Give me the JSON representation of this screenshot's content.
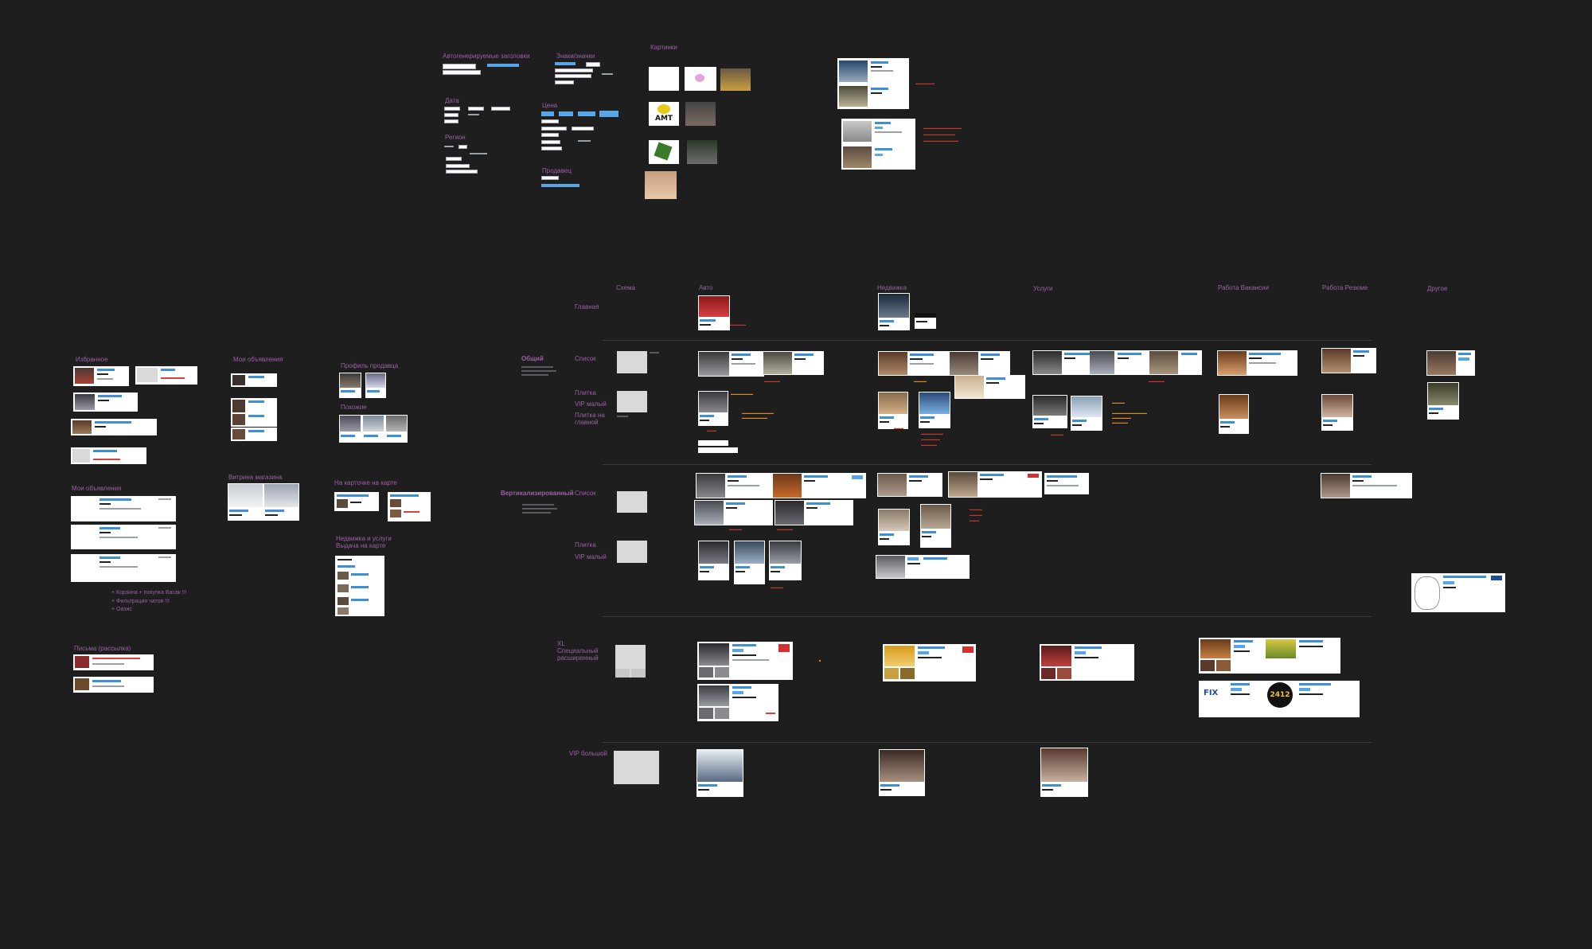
{
  "top_sections": {
    "auto_headers": "Автогенерируемые заголовки",
    "date": "Дата",
    "region": "Регион",
    "signs_icons": "Знаки/значки",
    "price": "Цена",
    "seller": "Продавец",
    "pictures": "Картинки"
  },
  "brand_logo": {
    "amt": "AMT"
  },
  "columns": {
    "scheme": "Схема",
    "auto": "Авто",
    "realty": "Недвижка",
    "services": "Услуги",
    "jobs_vacancies": "Работа Вакансии",
    "jobs_resume": "Работа Резюме",
    "other": "Другое"
  },
  "rows": {
    "main": "Главная",
    "general": "Общий",
    "list": "Список",
    "tile": "Плитка",
    "vip_small": "VIP малый",
    "tile_on_main": "Плитка на главной",
    "vertical": "Вертикализированный",
    "list2": "Список",
    "tile2": "Плитка",
    "vip_small2": "VIP малый",
    "xl_special": "XL Специальный расширенный",
    "vip_big": "VIP большой"
  },
  "left_sections": {
    "favorites": "Избранное",
    "my_ads_top": "Мои объявления",
    "seller_profile": "Профиль продавца",
    "similar": "Похожие",
    "shop_showcase": "Витрина магазина",
    "on_map_card": "На карточке на карте",
    "realty_services_map": "Недвижка и услуги Выдача на карте",
    "my_ads": "Мои объявления",
    "letters": "Письма (рассылка)"
  },
  "todo": [
    "+ Корзина + покупка Васак !!!",
    "+ Фильтрация чатов !!!",
    "+ Оазис"
  ],
  "taxi_badge": "2412",
  "fix_logo": "FIX",
  "colors": {
    "background": "#1e1e1f",
    "label": "#9b5fa3",
    "accent_blue": "#3d8fd6",
    "accent_red": "#d94040",
    "note_orange": "#d38a2a"
  }
}
